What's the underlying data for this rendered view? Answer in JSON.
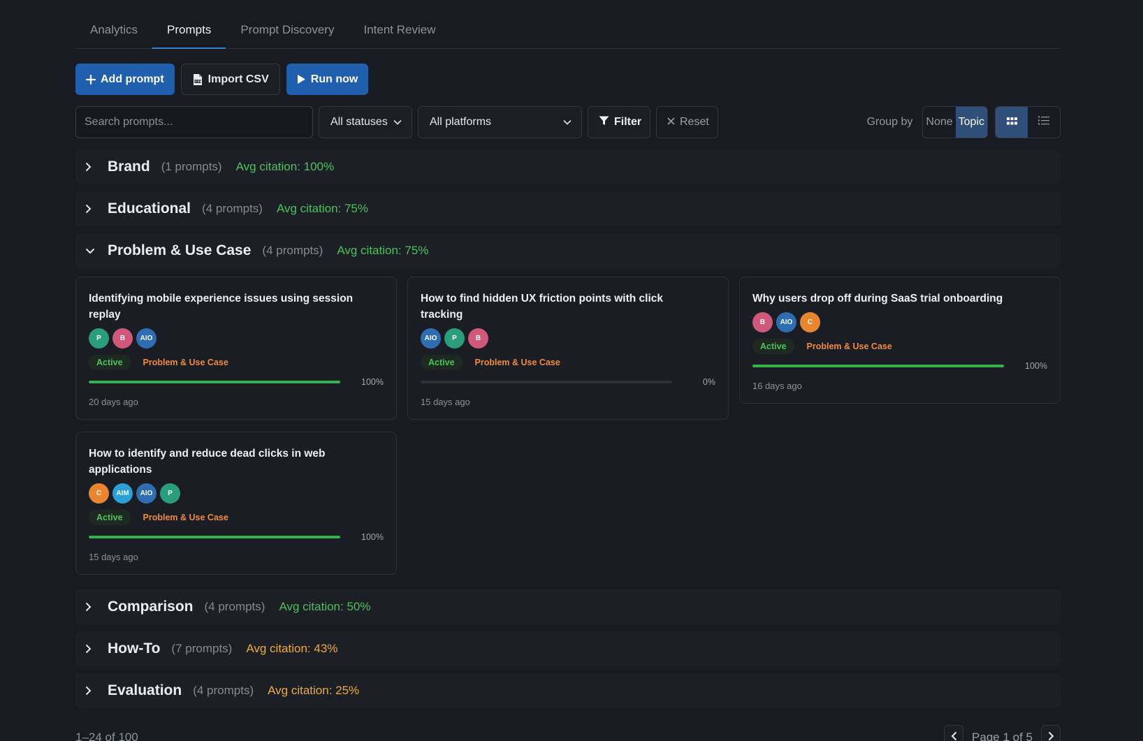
{
  "tabs": [
    {
      "label": "Analytics",
      "active": false
    },
    {
      "label": "Prompts",
      "active": true
    },
    {
      "label": "Prompt Discovery",
      "active": false
    },
    {
      "label": "Intent Review",
      "active": false
    }
  ],
  "toolbar": {
    "add_label": "Add prompt",
    "import_label": "Import CSV",
    "run_label": "Run now"
  },
  "filters": {
    "search_placeholder": "Search prompts...",
    "status_value": "All statuses",
    "platform_value": "All platforms",
    "filter_label": "Filter",
    "reset_label": "Reset",
    "group_by_label": "Group by",
    "group_none": "None",
    "group_topic": "Topic",
    "group_selected": "Topic"
  },
  "colors": {
    "accent": "#1f5fae",
    "good": "#4bc15a",
    "warn": "#f0a93c",
    "topic": "#f08a3c"
  },
  "groups_top": [
    {
      "name": "Brand",
      "count": "(1 prompts)",
      "avg": "Avg citation: 100%",
      "tone": "good"
    },
    {
      "name": "Educational",
      "count": "(4 prompts)",
      "avg": "Avg citation: 75%",
      "tone": "good"
    }
  ],
  "expanded_group": {
    "name": "Problem & Use Case",
    "count": "(4 prompts)",
    "avg": "Avg citation: 75%",
    "tone": "good"
  },
  "cards": [
    {
      "title": "Identifying mobile experience issues using session replay",
      "platforms": [
        "P",
        "B",
        "AIO"
      ],
      "status": "Active",
      "topic": "Problem & Use Case",
      "citation": 1.0,
      "pct": "100%",
      "when": "20 days ago"
    },
    {
      "title": "How to find hidden UX friction points with click tracking",
      "platforms": [
        "AIO",
        "P",
        "B"
      ],
      "status": "Active",
      "topic": "Problem & Use Case",
      "citation": 0.0,
      "pct": "0%",
      "when": "15 days ago"
    },
    {
      "title": "Why users drop off during SaaS trial onboarding",
      "platforms": [
        "B",
        "AIO",
        "C"
      ],
      "status": "Active",
      "topic": "Problem & Use Case",
      "citation": 1.0,
      "pct": "100%",
      "when": "16 days ago"
    },
    {
      "title": "How to identify and reduce dead clicks in web applications",
      "platforms": [
        "C",
        "AIM",
        "AIO",
        "P"
      ],
      "status": "Active",
      "topic": "Problem & Use Case",
      "citation": 1.0,
      "pct": "100%",
      "when": "15 days ago"
    }
  ],
  "platform_colors": {
    "P": "#2a9d7c",
    "B": "#d0587a",
    "AIO": "#2f6db3",
    "C": "#e8852e",
    "AIM": "#2b9fd8"
  },
  "groups_bottom": [
    {
      "name": "Comparison",
      "count": "(4 prompts)",
      "avg": "Avg citation: 50%",
      "tone": "good"
    },
    {
      "name": "How-To",
      "count": "(7 prompts)",
      "avg": "Avg citation: 43%",
      "tone": "warn"
    },
    {
      "name": "Evaluation",
      "count": "(4 prompts)",
      "avg": "Avg citation: 25%",
      "tone": "warn"
    }
  ],
  "footer": {
    "range": "1–24 of 100",
    "page_label": "Page 1 of 5"
  }
}
